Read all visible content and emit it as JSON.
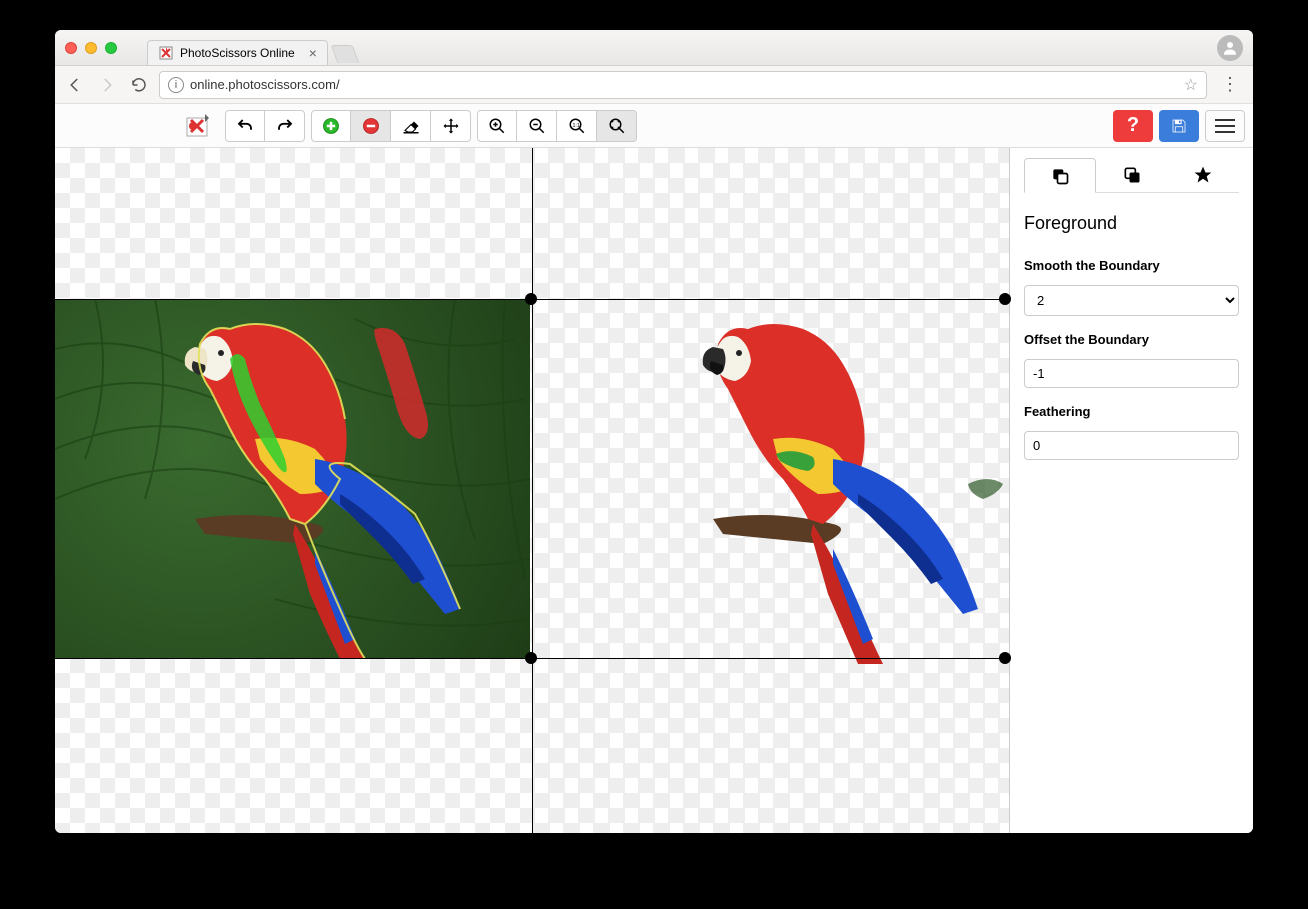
{
  "browser": {
    "tab_title": "PhotoScissors Online",
    "url": "online.photoscissors.com/"
  },
  "sidebar": {
    "panel_title": "Foreground",
    "smooth_label": "Smooth the Boundary",
    "smooth_value": "2",
    "offset_label": "Offset the Boundary",
    "offset_value": "-1",
    "feathering_label": "Feathering",
    "feathering_value": "0"
  }
}
